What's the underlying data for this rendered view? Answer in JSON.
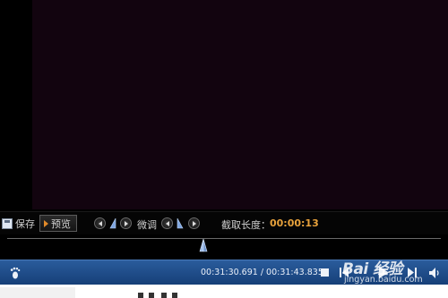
{
  "clip_toolbar": {
    "save_label": "保存",
    "preview_label": "预览",
    "fine_tune_label": "微调",
    "clip_length_label": "截取长度：",
    "clip_length_value": "00:00:13"
  },
  "player": {
    "time_display": "00:31:30.691 / 00:31:43.835"
  },
  "watermark": {
    "title": "Bai 经验",
    "subtitle": "jingyan.baidu.com"
  },
  "colors": {
    "accent_orange": "#e8a23c",
    "control_bar_top": "#2a5c9c",
    "control_bar_bottom": "#163f78",
    "video_background": "#12040f"
  },
  "icons": {
    "save": "floppy-disk-icon",
    "preview": "play-triangle-icon",
    "step_back": "step-back-icon",
    "step_forward": "step-forward-icon",
    "start_marker": "start-marker-icon",
    "end_marker": "end-marker-icon",
    "timeline_marker": "playhead-marker-icon",
    "footprint": "footprint-icon",
    "stop": "stop-icon",
    "previous": "previous-icon",
    "play": "play-icon",
    "next": "next-icon",
    "volume": "volume-icon"
  }
}
